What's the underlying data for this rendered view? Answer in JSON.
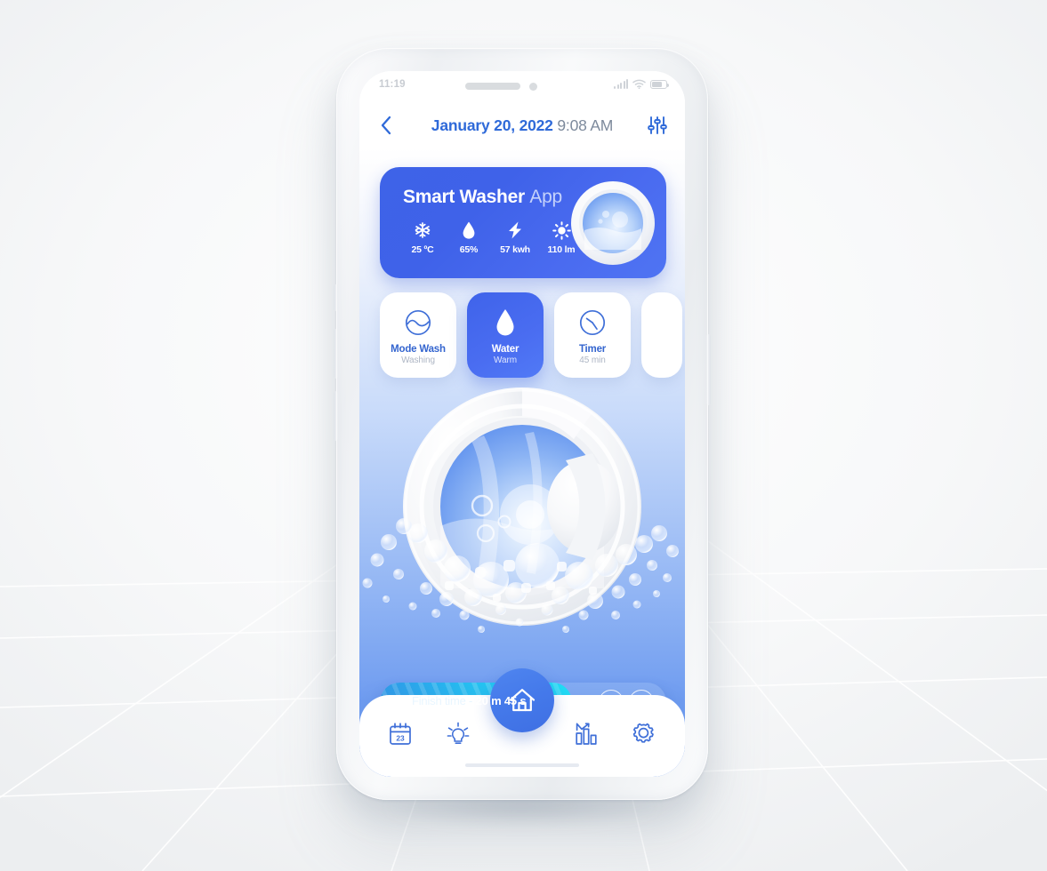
{
  "status_bar": {
    "time": "11:19",
    "signal_icon": "cellular-signal-icon",
    "wifi_icon": "wifi-icon",
    "battery_icon": "battery-icon"
  },
  "header": {
    "back_icon": "chevron-left-icon",
    "date": "January 20, 2022",
    "time": "9:08 AM",
    "settings_icon": "sliders-icon"
  },
  "hero": {
    "title_bold": "Smart Washer",
    "title_light": "App",
    "washer_icon": "washing-machine-icon",
    "stats": [
      {
        "icon": "snowflake-icon",
        "value": "25 ºC"
      },
      {
        "icon": "water-drop-icon",
        "value": "65%"
      },
      {
        "icon": "lightning-bolt-icon",
        "value": "57 kwh"
      },
      {
        "icon": "sun-icon",
        "value": "110 lm"
      }
    ]
  },
  "modes": [
    {
      "icon": "wash-cycle-icon",
      "title": "Mode Wash",
      "subtitle": "Washing",
      "active": false
    },
    {
      "icon": "water-drop-icon",
      "title": "Water",
      "subtitle": "Warm",
      "active": true
    },
    {
      "icon": "clock-icon",
      "title": "Timer",
      "subtitle": "45 min",
      "active": false
    },
    {
      "icon": "",
      "title": "",
      "subtitle": "",
      "active": false
    }
  ],
  "progress": {
    "label": "Finish time - ",
    "value": "20 m 45 s",
    "percent": 67,
    "pause_icon": "pause-icon",
    "power_icon": "power-icon"
  },
  "bottom_nav": {
    "items": [
      {
        "icon": "calendar-icon",
        "badge": "23"
      },
      {
        "icon": "lightbulb-icon",
        "badge": ""
      },
      {
        "icon": "chart-bar-icon",
        "badge": ""
      },
      {
        "icon": "gear-icon",
        "badge": ""
      }
    ],
    "fab_icon": "home-icon"
  },
  "colors": {
    "brand_blue": "#3f63ea",
    "accent_cyan": "#23d3f4",
    "title_blue": "#2f6ad9",
    "muted": "#aeb6c4"
  }
}
